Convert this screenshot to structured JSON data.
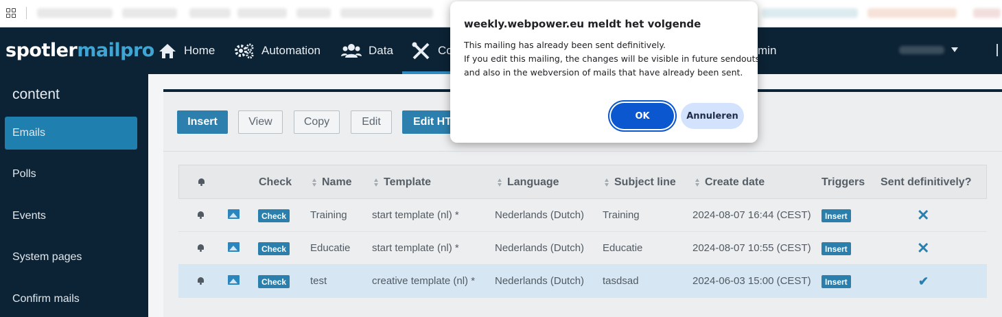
{
  "browser": {
    "bookmarks_blurred": true
  },
  "nav": {
    "logo_part1": "spotler",
    "logo_part2": "mailpro",
    "items": [
      {
        "label": "Home",
        "icon": "home-icon"
      },
      {
        "label": "Automation",
        "icon": "gears-icon"
      },
      {
        "label": "Data",
        "icon": "users-icon"
      },
      {
        "label": "Co",
        "icon": "tools-icon"
      },
      {
        "label": "min",
        "icon": ""
      }
    ],
    "user_menu": "blurred user name",
    "colors": {
      "bg": "#0c2335",
      "accent": "#3fa6d4"
    }
  },
  "sidebar": {
    "title": "content",
    "items": [
      {
        "label": "Emails",
        "active": true
      },
      {
        "label": "Polls"
      },
      {
        "label": "Events"
      },
      {
        "label": "System pages"
      },
      {
        "label": "Confirm mails"
      }
    ]
  },
  "toolbar": {
    "insert": "Insert",
    "view": "View",
    "copy": "Copy",
    "edit": "Edit",
    "edit_html": "Edit HT"
  },
  "table": {
    "headers": {
      "check": "Check",
      "name": "Name",
      "template": "Template",
      "language": "Language",
      "subject": "Subject line",
      "create_date": "Create date",
      "triggers": "Triggers",
      "sent": "Sent definitively?"
    },
    "rows": [
      {
        "check": "Check",
        "name": "Training",
        "template": "start template (nl) *",
        "language": "Nederlands (Dutch)",
        "subject": "Training",
        "create_date": "2024-08-07 16:44 (CEST)",
        "trigger": "Insert",
        "sent": false
      },
      {
        "check": "Check",
        "name": "Educatie",
        "template": "start template (nl) *",
        "language": "Nederlands (Dutch)",
        "subject": "Educatie",
        "create_date": "2024-08-07 10:55 (CEST)",
        "trigger": "Insert",
        "sent": false
      },
      {
        "check": "Check",
        "name": "test",
        "template": "creative template (nl) *",
        "language": "Nederlands (Dutch)",
        "subject": "tasdsad",
        "create_date": "2024-06-03 15:00 (CEST)",
        "trigger": "Insert",
        "sent": true,
        "selected": true
      }
    ]
  },
  "dialog": {
    "title": "weekly.webpower.eu meldt het volgende",
    "line1": "This mailing has already been sent definitively.",
    "line2": "If you edit this mailing, the changes will be visible in future sendouts",
    "line3": "and also in the webversion of mails that have already been sent.",
    "ok": "OK",
    "cancel": "Annuleren"
  }
}
